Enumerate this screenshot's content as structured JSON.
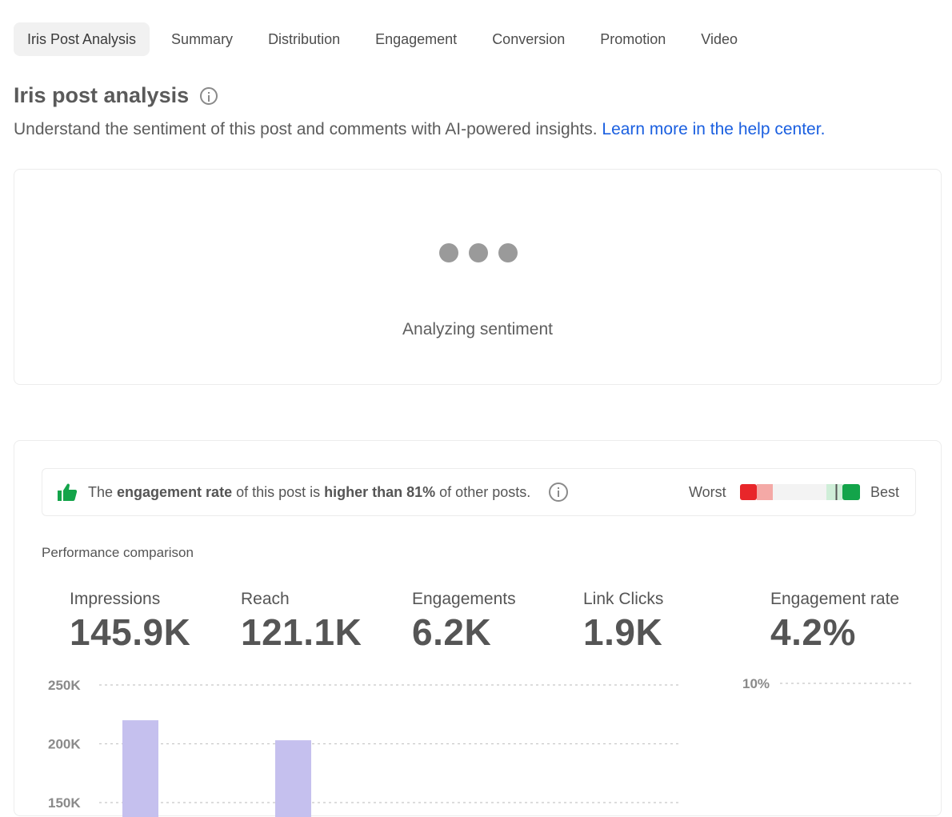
{
  "tabs": [
    "Iris Post Analysis",
    "Summary",
    "Distribution",
    "Engagement",
    "Conversion",
    "Promotion",
    "Video"
  ],
  "header": {
    "title": "Iris post analysis",
    "subtitle": "Understand the sentiment of this post and comments with AI-powered insights.",
    "help_link": "Learn more in the help center."
  },
  "sentiment": {
    "status": "Analyzing sentiment"
  },
  "banner": {
    "text_1": "The ",
    "bold_1": "engagement rate",
    "text_2": " of this post is ",
    "bold_2": "higher than 81%",
    "text_3": " of other posts.",
    "worst_label": "Worst",
    "best_label": "Best",
    "percentile": 0.81,
    "colors": {
      "worst": "#e8262a",
      "bad": "#f4a9a6",
      "good": "#cfeed8",
      "best": "#13a44a",
      "thumb": "#13a44a"
    },
    "icon": "thumbs-up-icon"
  },
  "performance": {
    "label": "Performance comparison",
    "metrics": [
      {
        "label": "Impressions",
        "value": "145.9K"
      },
      {
        "label": "Reach",
        "value": "121.1K"
      },
      {
        "label": "Engagements",
        "value": "6.2K"
      },
      {
        "label": "Link Clicks",
        "value": "1.9K"
      },
      {
        "label": "Engagement rate",
        "value": "4.2%"
      }
    ]
  },
  "chart_data": [
    {
      "type": "bar",
      "y_ticks": [
        "250K",
        "200K",
        "150K"
      ],
      "ylim": [
        150000,
        250000
      ],
      "categories": [
        "Impressions",
        "Reach"
      ],
      "values": [
        220000,
        203000
      ],
      "bar_color": "#c5c0ee",
      "grid": true
    },
    {
      "type": "bar",
      "y_ticks": [
        "10%"
      ],
      "grid": true
    }
  ]
}
